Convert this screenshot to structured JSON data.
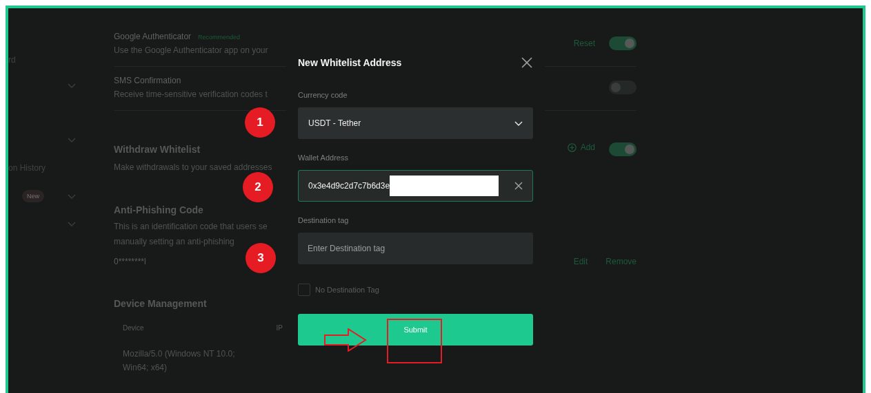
{
  "sidebar": {
    "items": [
      {
        "kind": "label",
        "text": "rd"
      },
      {
        "kind": "chevron"
      },
      {
        "kind": "chevron"
      },
      {
        "kind": "label",
        "text": "on History"
      },
      {
        "kind": "badge",
        "badge": "New"
      },
      {
        "kind": "chevron"
      }
    ]
  },
  "security_items": [
    {
      "title": "Google Authenticator",
      "tag": "Recommended",
      "description": "Use the Google Authenticator app on your",
      "action": "Reset",
      "on": true
    },
    {
      "title": "SMS Confirmation",
      "description": "Receive time-sensitive verification codes t",
      "on": false
    }
  ],
  "withdraw_whitelist": {
    "title": "Withdraw Whitelist",
    "description": "Make withdrawals to your saved addresses",
    "action": "Add",
    "on": true
  },
  "anti_phishing": {
    "title": "Anti-Phishing Code",
    "lines": [
      "This is an identification code that users se",
      "manually setting an anti-phishing"
    ],
    "code": "0********l",
    "actions": [
      "Edit",
      "Remove"
    ]
  },
  "device_management": {
    "title": "Device Management",
    "columns": [
      "Device",
      "IP"
    ],
    "rows": [
      [
        "Mozilla/5.0 (Windows NT 10.0; Win64; x64)"
      ]
    ]
  },
  "modal": {
    "title": "New Whitelist Address",
    "currency": {
      "label": "Currency code",
      "value": "USDT - Tether"
    },
    "wallet": {
      "label": "Wallet Address",
      "value": "0x3e4d9c2d7c7b6d3e"
    },
    "destination": {
      "label": "Destination tag",
      "placeholder": "Enter Destination tag"
    },
    "no_tag": {
      "label": "No Destination Tag",
      "checked": false
    },
    "submit": "Submit"
  },
  "annotations": {
    "markers": [
      "1",
      "2",
      "3"
    ]
  }
}
